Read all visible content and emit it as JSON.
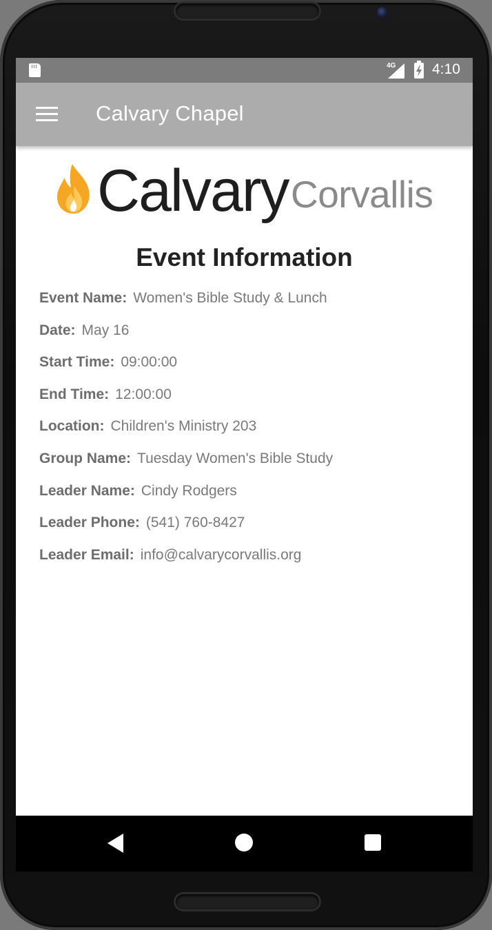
{
  "status_bar": {
    "network": "4G",
    "time": "4:10"
  },
  "app_bar": {
    "title": "Calvary Chapel",
    "menu_icon": "hamburger-menu-icon"
  },
  "logo": {
    "word1": "Calvary",
    "word2": "Corvallis",
    "flame_color": "#f5a623"
  },
  "event": {
    "heading": "Event Information",
    "fields": [
      {
        "label": "Event Name:",
        "value": "Women's Bible Study & Lunch"
      },
      {
        "label": "Date:",
        "value": "May 16"
      },
      {
        "label": "Start Time:",
        "value": "09:00:00"
      },
      {
        "label": "End Time:",
        "value": "12:00:00"
      },
      {
        "label": "Location:",
        "value": "Children's Ministry 203"
      },
      {
        "label": "Group Name:",
        "value": "Tuesday Women's Bible Study"
      },
      {
        "label": "Leader Name:",
        "value": "Cindy Rodgers"
      },
      {
        "label": "Leader Phone:",
        "value": "(541) 760-8427"
      },
      {
        "label": "Leader Email:",
        "value": "info@calvarycorvallis.org"
      }
    ]
  },
  "nav_bar": {
    "back_icon": "back-triangle-icon",
    "home_icon": "home-circle-icon",
    "recent_icon": "recent-apps-square-icon"
  },
  "colors": {
    "app_bar": "#acacac",
    "status_bar": "#7c7c7c",
    "content_bg": "#ffffff",
    "label_text": "#6d6d6d",
    "value_text": "#7a7a7a"
  }
}
